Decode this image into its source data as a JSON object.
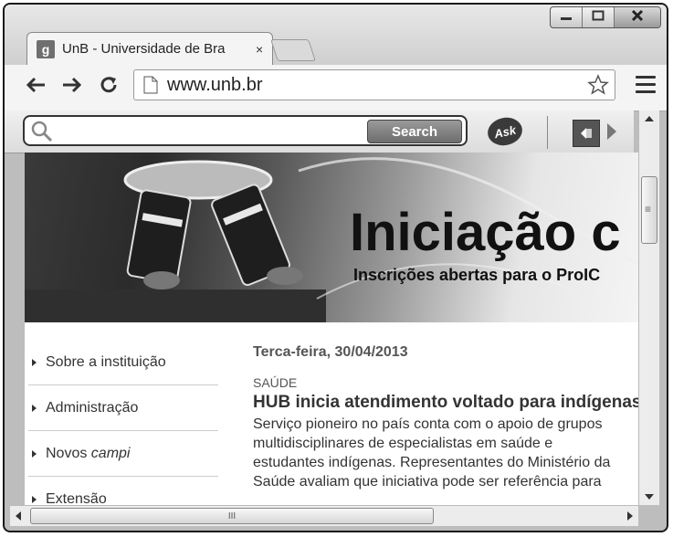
{
  "browser": {
    "tab_title": "UnB - Universidade de Bra",
    "tab_close": "×",
    "url": "www.unb.br"
  },
  "askbar": {
    "search_label": "Search",
    "search_placeholder": "",
    "logo_text": "Ask"
  },
  "banner": {
    "headline": "Iniciação c",
    "subline": "Inscrições abertas para o ProIC"
  },
  "sidebar": {
    "items": [
      {
        "label": "Sobre a instituição"
      },
      {
        "label": "Administração"
      },
      {
        "label": "Novos campi"
      },
      {
        "label": "Extensão"
      }
    ]
  },
  "news": {
    "date": "Terca-feira, 30/04/2013",
    "category": "SAÚDE",
    "title": "HUB inicia atendimento voltado para indígenas",
    "body": "Serviço pioneiro no país conta com o apoio de grupos\nmultidisciplinares de especialistas em saúde e\nestudantes indígenas. Representantes do Ministério da\nSaúde avaliam que iniciativa pode ser referência para"
  },
  "scrollbar": {
    "hthumb_grip": "III",
    "vthumb_grip": "≡"
  },
  "icons": [
    "minimize-icon",
    "maximize-icon",
    "close-icon",
    "back-arrow-icon",
    "forward-arrow-icon",
    "reload-icon",
    "page-icon",
    "star-icon",
    "menu-icon",
    "search-icon",
    "ask-logo-icon",
    "extension-icon"
  ]
}
